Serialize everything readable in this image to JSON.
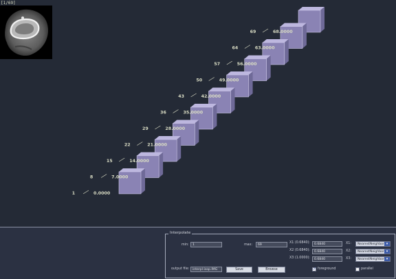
{
  "viewer": {
    "counter": "[1/69]",
    "slices": [
      {
        "index": "1",
        "position": "0.0000"
      },
      {
        "index": "8",
        "position": "7.0000"
      },
      {
        "index": "15",
        "position": "14.0000"
      },
      {
        "index": "22",
        "position": "21.0000"
      },
      {
        "index": "29",
        "position": "28.0000"
      },
      {
        "index": "36",
        "position": "35.0000"
      },
      {
        "index": "43",
        "position": "42.0000"
      },
      {
        "index": "50",
        "position": "49.0000"
      },
      {
        "index": "57",
        "position": "56.0000"
      },
      {
        "index": "64",
        "position": "63.0000"
      },
      {
        "index": "69",
        "position": "68.0000"
      }
    ],
    "colors": {
      "background": "#242a36",
      "slice_face": "#8a83b4",
      "label": "#d9dcc4"
    }
  },
  "interpolate": {
    "title": "Interpolate",
    "min_label": "min:",
    "min_value": "1",
    "max_label": "max:",
    "max_value": "69",
    "x1_label": "X1 (0.6840):",
    "x1_value": "0.6840",
    "x2_label": "X2 (0.6840):",
    "x2_value": "0.6840",
    "x3_label": "X3 (1.0000):",
    "x3_value": "0.6840",
    "method_x1_label": "X1:",
    "method_x1": "NearestNeighbor",
    "method_x2_label": "X2:",
    "method_x2": "NearestNeighbor",
    "method_x3_label": "X3:",
    "method_x3": "NearestNeighbor",
    "output_label": "output file:",
    "output_value": "interpl-isop.IMG",
    "save_label": "Save",
    "browse_label": "Browse",
    "foreground_label": "foreground",
    "foreground_checked": true,
    "parallel_label": "parallel",
    "parallel_checked": false
  }
}
